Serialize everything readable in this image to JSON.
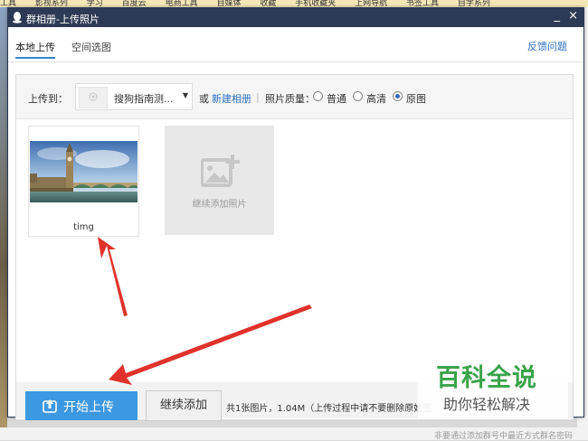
{
  "background": {
    "bookmarks": [
      "工具",
      "影视系列",
      "学习",
      "百度云",
      "电商工具",
      "自媒体",
      "收藏",
      "手机收藏夹",
      "上网导航",
      "书签工具",
      "自学系列"
    ],
    "bottom_text": "非要通过添加群号中最近方式群名密码"
  },
  "window": {
    "title": "群相册-上传照片",
    "minimize": "_",
    "close": "×"
  },
  "tabs": {
    "local": "本地上传",
    "space": "空间选图",
    "feedback": "反馈问题"
  },
  "toolbar": {
    "upload_to_label": "上传到：",
    "album_name": "搜狗指南测...",
    "or_text": "或",
    "new_album": "新建相册",
    "separator": "|",
    "quality_label": "照片质量：",
    "quality_options": [
      "普通",
      "高清",
      "原图"
    ],
    "quality_selected": "原图"
  },
  "photos": [
    {
      "name": "timg"
    }
  ],
  "add_more": {
    "label": "继续添加照片"
  },
  "footer": {
    "start_button": "开始上传",
    "continue_button": "继续添加",
    "summary": "共1张图片，1.04M（上传过程中请不要删除原始图"
  },
  "watermark": {
    "main": "百科全说",
    "sub": "助你轻松解决"
  },
  "colors": {
    "titlebar": "#2d3a55",
    "accent": "#3c98e0",
    "link": "#2d6fbf",
    "arrow": "#e0322b",
    "watermark_green": "#3aa34a"
  }
}
